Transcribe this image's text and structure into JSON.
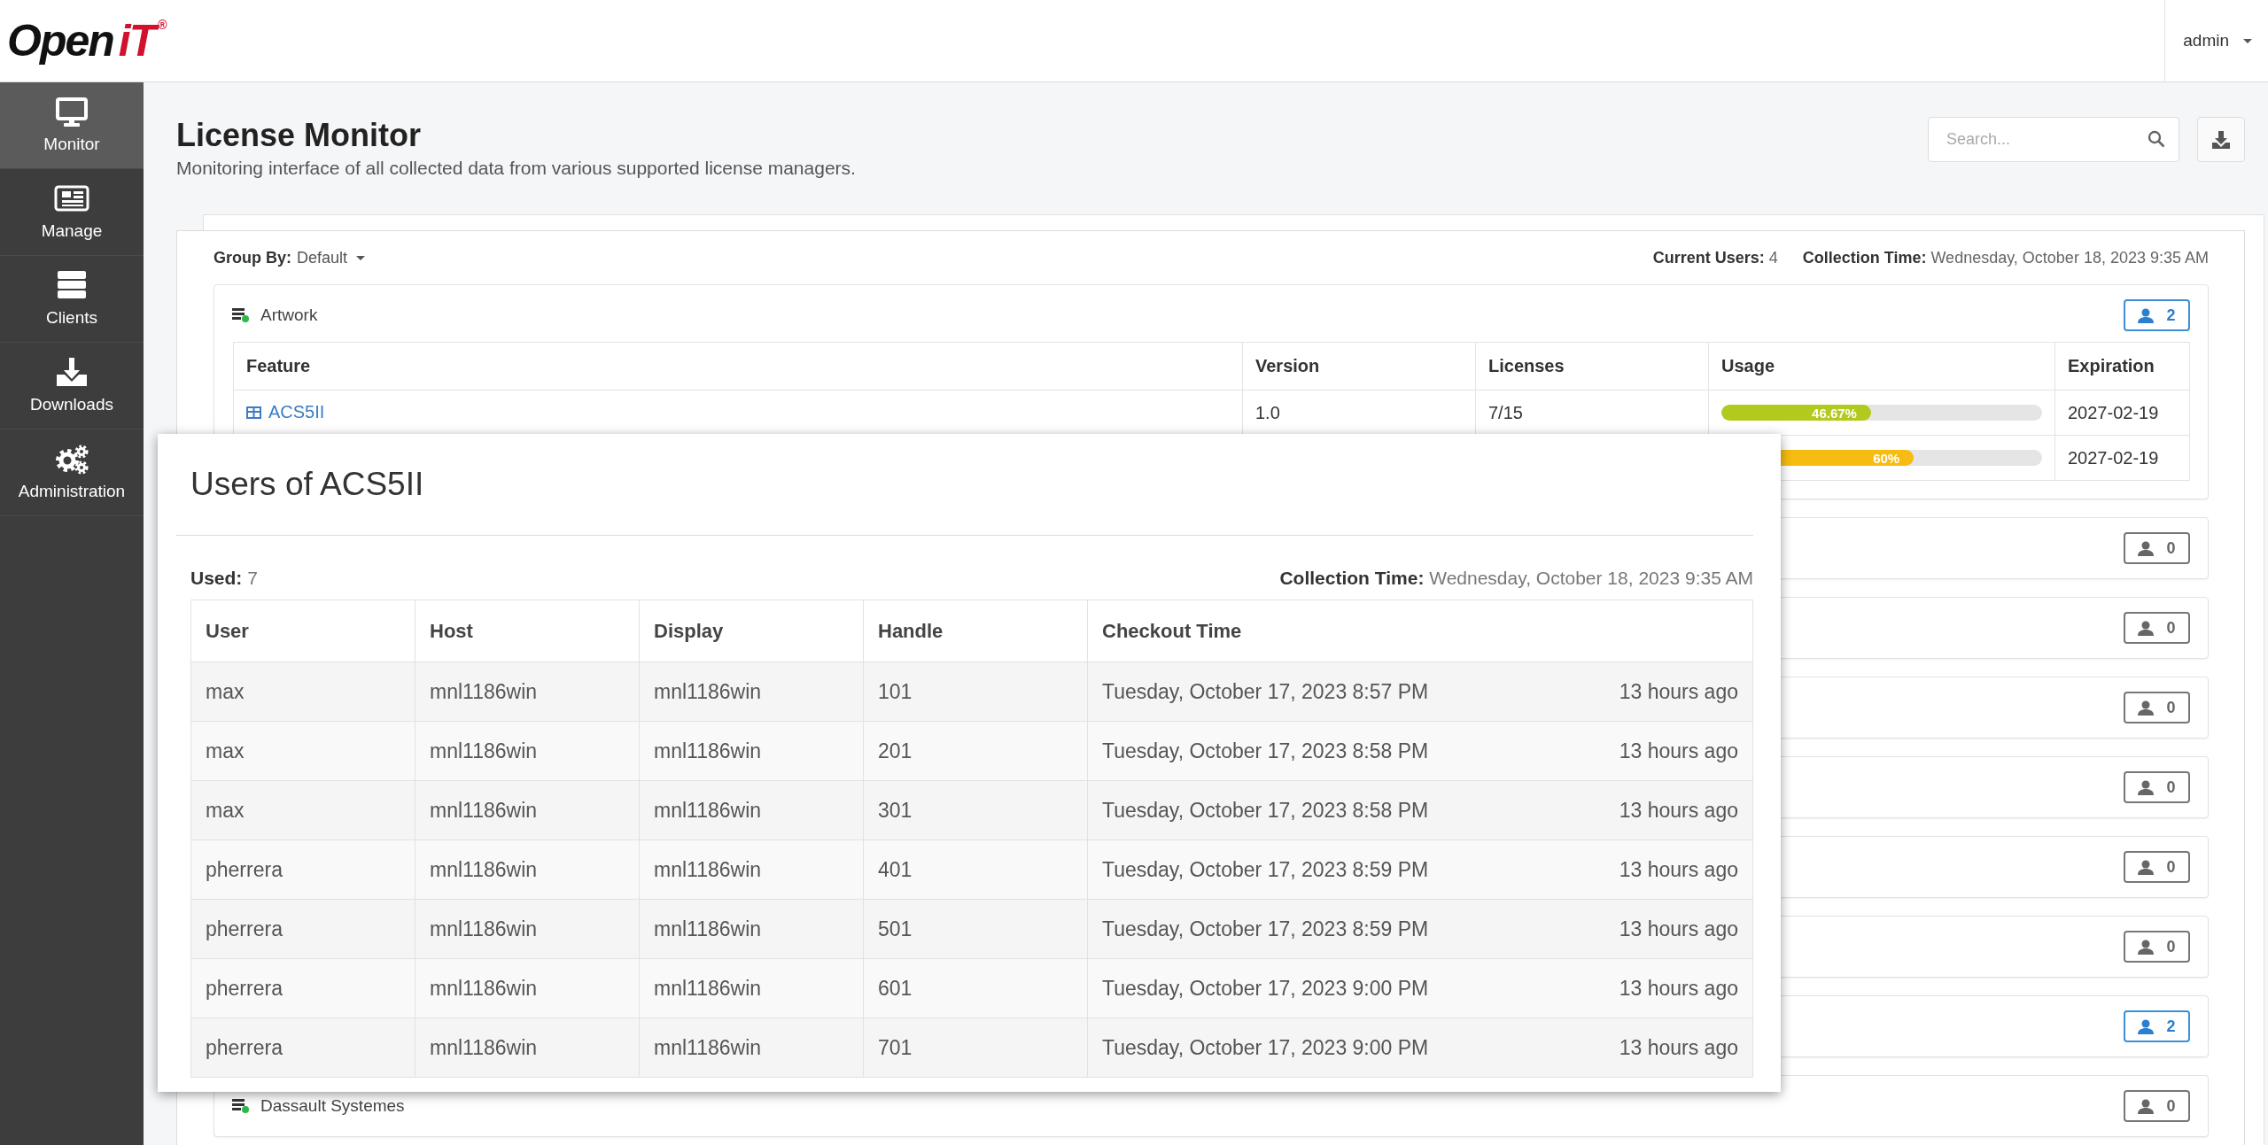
{
  "logo": {
    "dark": "Open",
    "accent": "iT",
    "mark": "®"
  },
  "user_menu": {
    "label": "admin"
  },
  "sidebar": {
    "items": [
      {
        "label": "Monitor",
        "kind": "monitor",
        "selected": true
      },
      {
        "label": "Manage",
        "kind": "manage",
        "selected": false
      },
      {
        "label": "Clients",
        "kind": "clients",
        "selected": false
      },
      {
        "label": "Downloads",
        "kind": "downloads",
        "selected": false
      },
      {
        "label": "Administration",
        "kind": "administration",
        "selected": false
      }
    ]
  },
  "page": {
    "title": "License Monitor",
    "subtitle": "Monitoring interface of all collected data from various supported license managers."
  },
  "search": {
    "placeholder": "Search..."
  },
  "group_by": {
    "label": "Group By:",
    "value": "Default"
  },
  "summary": [
    "**Current Users:** 4",
    "**Collection Time:** Wednesday, October 18, 2023 9:35 AM"
  ],
  "panels": [
    {
      "name": "Artwork",
      "users": "2",
      "active": true,
      "table": {
        "columns": [
          "Feature",
          "Version",
          "Licenses",
          "Usage",
          "Expiration"
        ],
        "rows": [
          {
            "feature": "ACS5II",
            "version": "1.0",
            "licenses": "7/15",
            "usage": {
              "label": "46.67%",
              "level": 0.4667,
              "color": "#b2c91d"
            },
            "expiration": "2027-02-19"
          },
          {
            "usage": {
              "label": "60%",
              "level": 0.6,
              "color": "#f7bc12"
            },
            "expiration": "2027-02-19"
          }
        ]
      }
    },
    {
      "users": "0",
      "active": false
    },
    {
      "users": "0",
      "active": false
    },
    {
      "users": "0",
      "active": false
    },
    {
      "users": "0",
      "active": false
    },
    {
      "users": "0",
      "active": false
    },
    {
      "users": "0",
      "active": false
    },
    {
      "users": "2",
      "active": true
    },
    {
      "name": "Dassault Systemes",
      "users": "0",
      "active": false
    }
  ],
  "modal": {
    "title": "Users of ACS5II",
    "used": "**Used:** 7",
    "collection": "**Collection Time:** Wednesday, October 18, 2023 9:35 AM",
    "columns": [
      "User",
      "Host",
      "Display",
      "Handle",
      "Checkout Time"
    ],
    "rows": [
      {
        "user": "max",
        "host": "mnl1186win",
        "display": "mnl1186win",
        "handle": "101",
        "checkout": "Tuesday, October 17, 2023 8:57 PM",
        "ago": "13 hours ago"
      },
      {
        "user": "max",
        "host": "mnl1186win",
        "display": "mnl1186win",
        "handle": "201",
        "checkout": "Tuesday, October 17, 2023 8:58 PM",
        "ago": "13 hours ago"
      },
      {
        "user": "max",
        "host": "mnl1186win",
        "display": "mnl1186win",
        "handle": "301",
        "checkout": "Tuesday, October 17, 2023 8:58 PM",
        "ago": "13 hours ago"
      },
      {
        "user": "pherrera",
        "host": "mnl1186win",
        "display": "mnl1186win",
        "handle": "401",
        "checkout": "Tuesday, October 17, 2023 8:59 PM",
        "ago": "13 hours ago"
      },
      {
        "user": "pherrera",
        "host": "mnl1186win",
        "display": "mnl1186win",
        "handle": "501",
        "checkout": "Tuesday, October 17, 2023 8:59 PM",
        "ago": "13 hours ago"
      },
      {
        "user": "pherrera",
        "host": "mnl1186win",
        "display": "mnl1186win",
        "handle": "601",
        "checkout": "Tuesday, October 17, 2023 9:00 PM",
        "ago": "13 hours ago"
      },
      {
        "user": "pherrera",
        "host": "mnl1186win",
        "display": "mnl1186win",
        "handle": "701",
        "checkout": "Tuesday, October 17, 2023 9:00 PM",
        "ago": "13 hours ago"
      }
    ]
  }
}
